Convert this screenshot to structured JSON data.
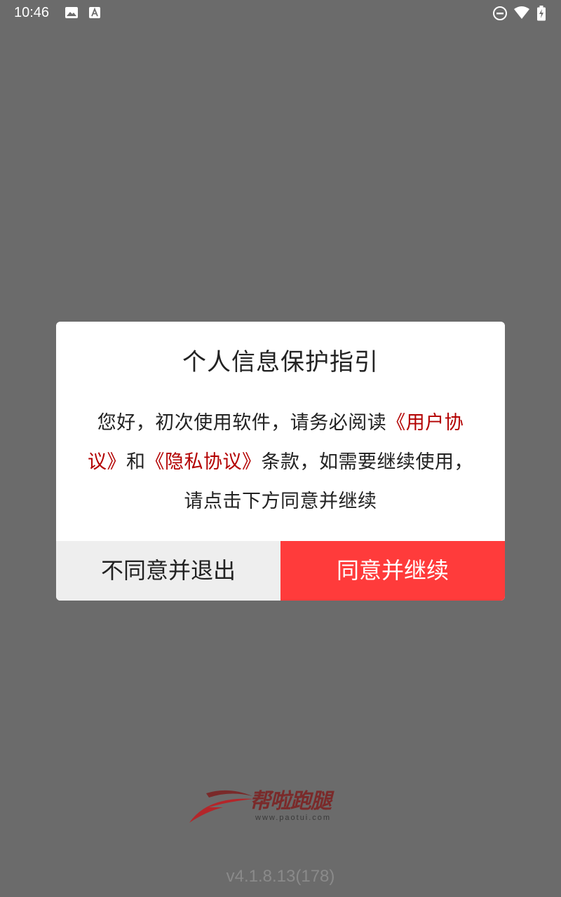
{
  "status_bar": {
    "time": "10:46",
    "icons": [
      "gallery-icon",
      "font-icon",
      "do-not-disturb-icon",
      "wifi-icon",
      "battery-charging-icon"
    ]
  },
  "dialog": {
    "title": "个人信息保护指引",
    "body": {
      "part1": "您好，初次使用软件，请务必阅读",
      "user_agreement": "《用户协议》",
      "part2": "和",
      "privacy_agreement": "《隐私协议》",
      "part3": "条款，如需要继续使用，请点击下方同意并继续"
    },
    "decline_label": "不同意并退出",
    "accept_label": "同意并继续"
  },
  "logo": {
    "name": "帮啦跑腿",
    "url": "www.paotui.com"
  },
  "version": "v4.1.8.13(178)",
  "colors": {
    "background": "#6b6b6b",
    "accent": "#ff3b3b",
    "link": "#b30000",
    "decline_bg": "#eeeeee"
  }
}
